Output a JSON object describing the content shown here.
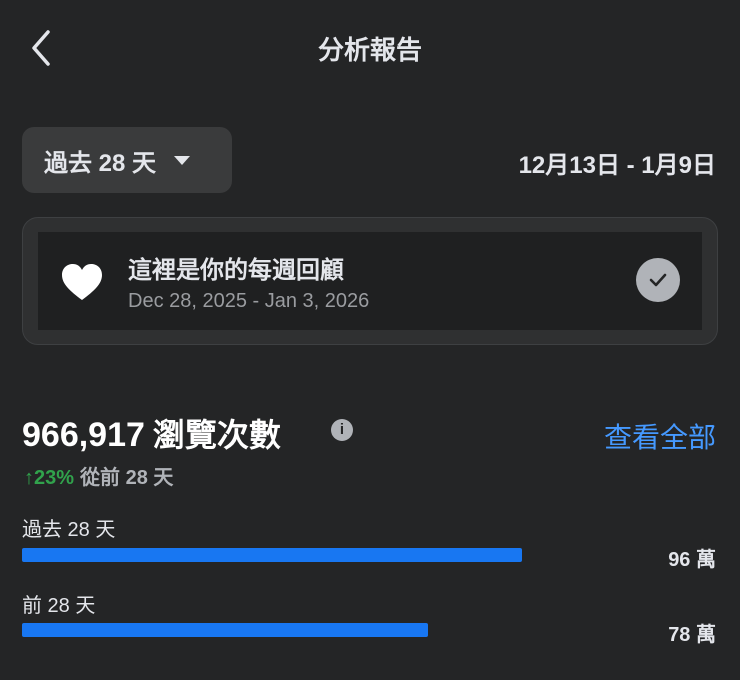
{
  "colors": {
    "background": "#242526",
    "accent": "#4599ff",
    "positive": "#31a24c",
    "bar": "#1877f2"
  },
  "header": {
    "title": "分析報告",
    "back_icon": "chevron-left-icon"
  },
  "filter": {
    "range_label": "過去 28 天",
    "date_range": "12月13日 - 1月9日"
  },
  "recap": {
    "title": "這裡是你的每週回顧",
    "dates": "Dec 28, 2025 - Jan 3, 2026",
    "leading_icon": "heart-icon",
    "trailing_icon": "check-circle-icon"
  },
  "views": {
    "count": "966,917",
    "label": "瀏覽次數",
    "info_glyph": "i",
    "see_all": "查看全部",
    "change_arrow": "↑",
    "change_percent": "23%",
    "change_text": "從前 28 天"
  },
  "comparison": [
    {
      "label": "過去 28 天",
      "value_text": "96 萬",
      "value": 96
    },
    {
      "label": "前 28 天",
      "value_text": "78 萬",
      "value": 78
    }
  ]
}
